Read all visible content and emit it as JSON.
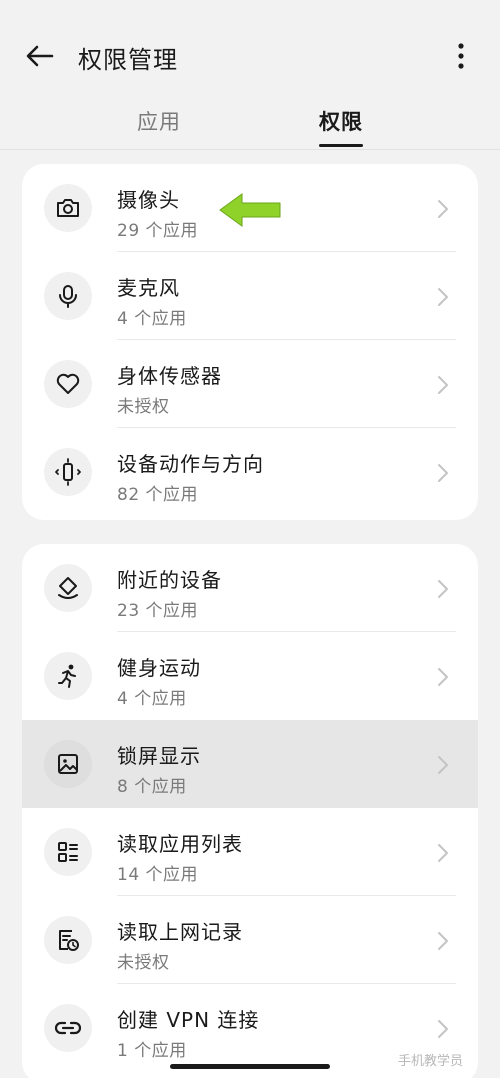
{
  "header": {
    "title": "权限管理",
    "back_icon": "arrow-left-icon",
    "more_icon": "more-vertical-icon"
  },
  "tabs": [
    {
      "label": "应用",
      "selected": false
    },
    {
      "label": "权限",
      "selected": true
    }
  ],
  "groups": [
    {
      "items": [
        {
          "title": "摄像头",
          "subtitle": "29 个应用",
          "icon": "camera-icon"
        },
        {
          "title": "麦克风",
          "subtitle": "4 个应用",
          "icon": "microphone-icon"
        },
        {
          "title": "身体传感器",
          "subtitle": "未授权",
          "icon": "heart-icon"
        },
        {
          "title": "设备动作与方向",
          "subtitle": "82 个应用",
          "icon": "device-motion-icon"
        }
      ]
    },
    {
      "items": [
        {
          "title": "附近的设备",
          "subtitle": "23 个应用",
          "icon": "nearby-devices-icon"
        },
        {
          "title": "健身运动",
          "subtitle": "4 个应用",
          "icon": "running-icon"
        },
        {
          "title": "锁屏显示",
          "subtitle": "8 个应用",
          "icon": "image-icon",
          "highlighted": true
        },
        {
          "title": "读取应用列表",
          "subtitle": "14 个应用",
          "icon": "app-list-icon"
        },
        {
          "title": "读取上网记录",
          "subtitle": "未授权",
          "icon": "browsing-history-icon"
        },
        {
          "title": "创建 VPN 连接",
          "subtitle": "1 个应用",
          "icon": "link-icon"
        }
      ]
    }
  ],
  "annotation": {
    "icon": "green-arrow-icon",
    "color": "#8fd32a"
  },
  "watermark": {
    "text": "手机教学员"
  },
  "colors": {
    "background": "#f2f2f2",
    "card": "#ffffff",
    "highlight": "#e6e6e6",
    "subtitle": "#7a7a7a"
  }
}
